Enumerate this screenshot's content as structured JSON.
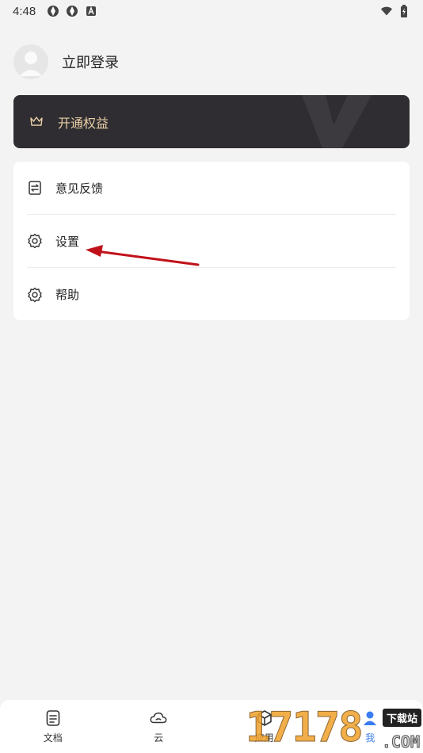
{
  "status_bar": {
    "time": "4:48",
    "left_icons": [
      "aperture-icon",
      "aperture-icon",
      "a-badge-icon"
    ],
    "right_icons": [
      "wifi-icon",
      "battery-charging-icon"
    ]
  },
  "profile": {
    "login_label": "立即登录"
  },
  "vip": {
    "label": "开通权益",
    "icon": "crown-icon",
    "text_color": "#e9cfa6",
    "bg_color": "#2f2d32"
  },
  "menu": {
    "items": [
      {
        "label": "意见反馈",
        "icon": "feedback-icon"
      },
      {
        "label": "设置",
        "icon": "gear-icon"
      },
      {
        "label": "帮助",
        "icon": "help-gear-icon"
      }
    ]
  },
  "bottom_nav": {
    "items": [
      {
        "label": "文档",
        "icon": "document-icon"
      },
      {
        "label": "云",
        "icon": "cloud-icon"
      },
      {
        "label": "应用",
        "icon": "cube-icon"
      },
      {
        "label": "我",
        "icon": "person-icon"
      }
    ]
  },
  "watermark": {
    "digits": "17178",
    "badge": "下载站",
    "suffix": ".COM"
  }
}
